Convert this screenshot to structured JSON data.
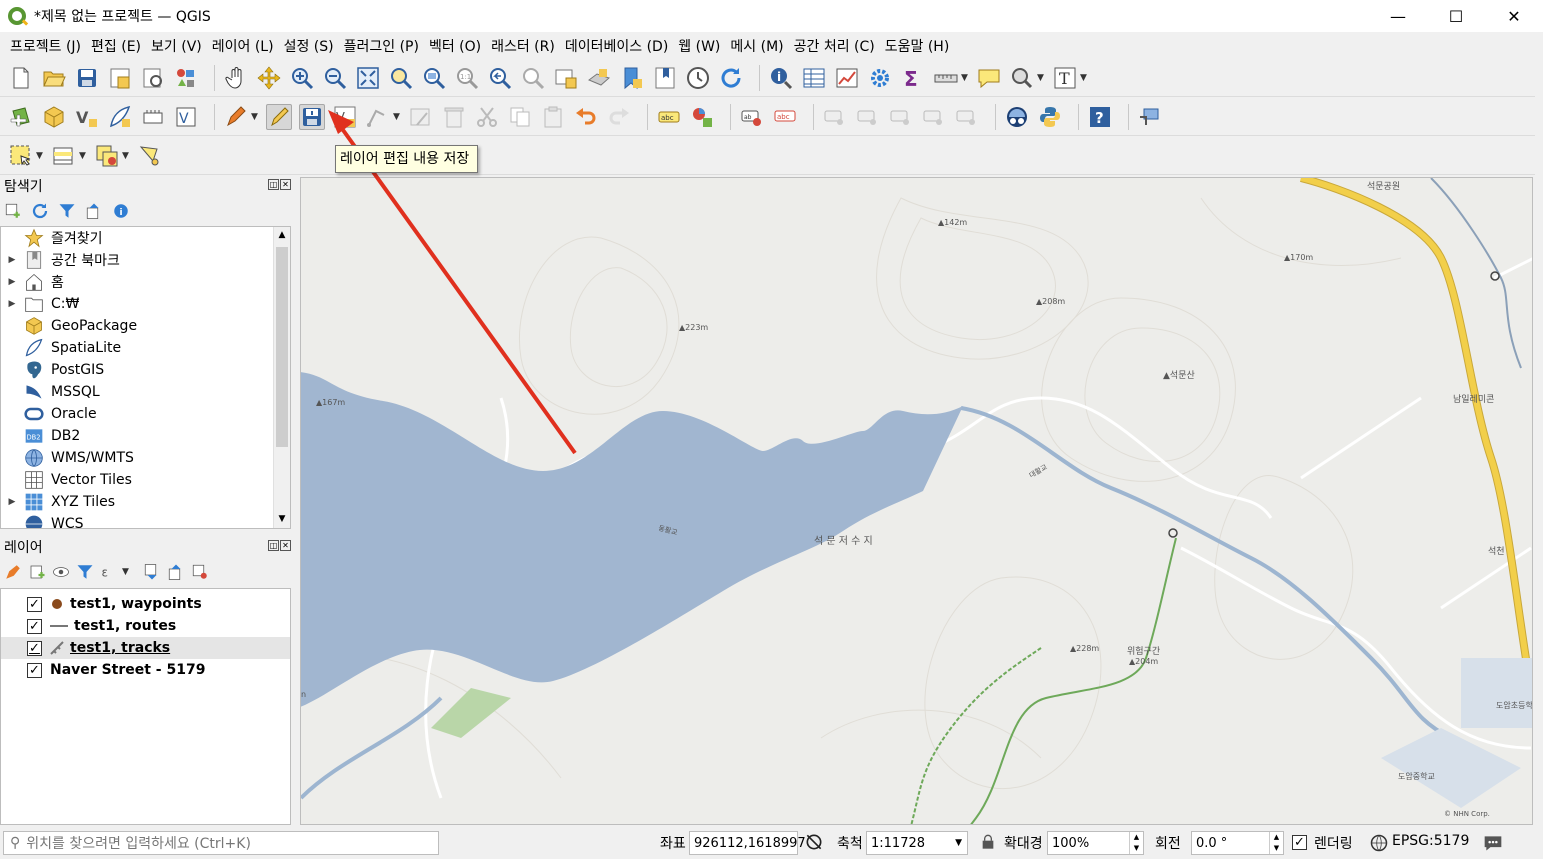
{
  "window": {
    "title": "*제목 없는 프로젝트 — QGIS",
    "minimize": "—",
    "maximize": "☐",
    "close": "✕"
  },
  "menu": [
    "프로젝트 (J)",
    "편집 (E)",
    "보기 (V)",
    "레이어 (L)",
    "설정 (S)",
    "플러그인 (P)",
    "벡터 (O)",
    "래스터 (R)",
    "데이터베이스 (D)",
    "웹 (W)",
    "메시 (M)",
    "공간 처리 (C)",
    "도움말 (H)"
  ],
  "tooltip": {
    "text": "레이어 편집 내용 저장"
  },
  "browser": {
    "title": "탐색기",
    "items": [
      {
        "label": "즐겨찾기",
        "icon": "star-icon",
        "expandable": false
      },
      {
        "label": "공간 북마크",
        "icon": "bookmark-icon",
        "expandable": true
      },
      {
        "label": "홈",
        "icon": "home-icon",
        "expandable": true
      },
      {
        "label": "C:₩",
        "icon": "folder-icon",
        "expandable": true
      },
      {
        "label": "GeoPackage",
        "icon": "geopackage-icon",
        "expandable": false
      },
      {
        "label": "SpatiaLite",
        "icon": "spatialite-icon",
        "expandable": false
      },
      {
        "label": "PostGIS",
        "icon": "postgis-icon",
        "expandable": false
      },
      {
        "label": "MSSQL",
        "icon": "mssql-icon",
        "expandable": false
      },
      {
        "label": "Oracle",
        "icon": "oracle-icon",
        "expandable": false
      },
      {
        "label": "DB2",
        "icon": "db2-icon",
        "expandable": false
      },
      {
        "label": "WMS/WMTS",
        "icon": "wms-icon",
        "expandable": false
      },
      {
        "label": "Vector Tiles",
        "icon": "vector-tiles-icon",
        "expandable": false
      },
      {
        "label": "XYZ Tiles",
        "icon": "xyz-tiles-icon",
        "expandable": true
      },
      {
        "label": "WCS",
        "icon": "wcs-icon",
        "expandable": false
      }
    ]
  },
  "layers": {
    "title": "레이어",
    "items": [
      {
        "label": "test1, waypoints",
        "checked": true,
        "symbol": "point"
      },
      {
        "label": "test1, routes",
        "checked": true,
        "symbol": "line"
      },
      {
        "label": "test1, tracks",
        "checked": true,
        "symbol": "track"
      },
      {
        "label": "Naver Street - 5179",
        "checked": true,
        "symbol": "none"
      }
    ]
  },
  "map": {
    "labels": {
      "reservoir": "석 문 저 수 지",
      "peak_142": "▲142m",
      "peak_170": "▲170m",
      "peak_208": "▲208m",
      "peak_223": "▲223m",
      "peak_167": "▲167m",
      "mountain": "▲석문산",
      "park": "석문공원",
      "village": "남일레미콘",
      "bridge": "동활교",
      "bridge2": "대활교",
      "peak_228": "▲228m",
      "peak_204": "▲204m",
      "hazard": "위험구간",
      "seokcheon": "석천",
      "school1": "도암초등학",
      "school2": "도암중학교",
      "copyright": "© NHN Corp.",
      "edge_n": "n"
    }
  },
  "statusbar": {
    "search_placeholder": "위치를 찾으려면 입력하세요 (Ctrl+K)",
    "coord_label": "좌표",
    "coord_value": "926112,1618997",
    "scale_label": "축척",
    "scale_value": "1:11728",
    "magnifier_label": "확대경",
    "magnifier_value": "100%",
    "rotation_label": "회전",
    "rotation_value": "0.0 °",
    "render_label": "렌더링",
    "render_checked": true,
    "crs": "EPSG:5179"
  },
  "colors": {
    "water": "#a1b6d0",
    "land": "#ededea",
    "road_yellow": "#f2cf4a",
    "trail_green": "#6ea95a",
    "arrow_red": "#e0301e",
    "tooltip_bg": "#ffffe1"
  }
}
